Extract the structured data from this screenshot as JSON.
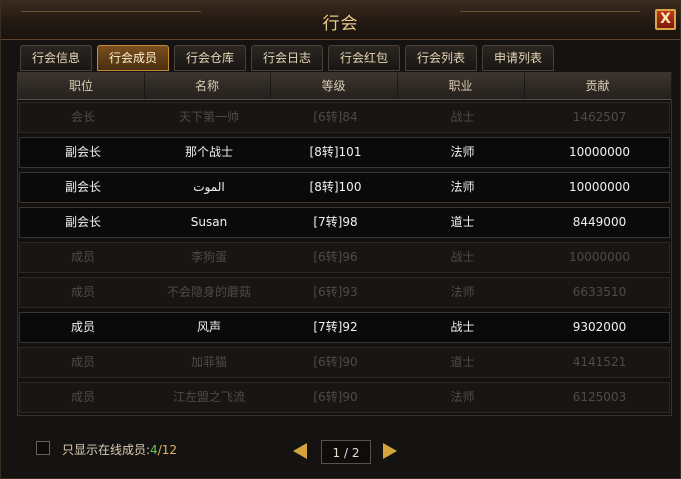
{
  "window": {
    "title": "行会",
    "close_label": "X"
  },
  "tabs": [
    {
      "label": "行会信息"
    },
    {
      "label": "行会成员"
    },
    {
      "label": "行会仓库"
    },
    {
      "label": "行会日志"
    },
    {
      "label": "行会红包"
    },
    {
      "label": "行会列表"
    },
    {
      "label": "申请列表"
    }
  ],
  "active_tab": 1,
  "columns": [
    "职位",
    "名称",
    "等级",
    "职业",
    "贡献"
  ],
  "members": [
    {
      "position": "会长",
      "name": "天下第一帅",
      "level": "[6转]84",
      "class": "战士",
      "contribution": "1462507",
      "online": false
    },
    {
      "position": "副会长",
      "name": "那个战士",
      "level": "[8转]101",
      "class": "法师",
      "contribution": "10000000",
      "online": true
    },
    {
      "position": "副会长",
      "name": "الموت",
      "level": "[8转]100",
      "class": "法师",
      "contribution": "10000000",
      "online": true
    },
    {
      "position": "副会长",
      "name": "Susan",
      "level": "[7转]98",
      "class": "道士",
      "contribution": "8449000",
      "online": true
    },
    {
      "position": "成员",
      "name": "李狗蛋",
      "level": "[6转]96",
      "class": "战士",
      "contribution": "10000000",
      "online": false
    },
    {
      "position": "成员",
      "name": "不会隐身的蘑菇",
      "level": "[6转]93",
      "class": "法师",
      "contribution": "6633510",
      "online": false
    },
    {
      "position": "成员",
      "name": "风声",
      "level": "[7转]92",
      "class": "战士",
      "contribution": "9302000",
      "online": true
    },
    {
      "position": "成员",
      "name": "加菲猫",
      "level": "[6转]90",
      "class": "道士",
      "contribution": "4141521",
      "online": false
    },
    {
      "position": "成员",
      "name": "江左盟之飞流",
      "level": "[6转]90",
      "class": "法师",
      "contribution": "6125003",
      "online": false
    }
  ],
  "footer": {
    "show_online_label": "只显示在线成员:",
    "online_count": "4",
    "separator": "/",
    "total_count": "12",
    "page_indicator": "1 / 2"
  },
  "colors": {
    "accent": "#d6a43c",
    "online_count": "#6ac84a",
    "active_tab": "#7a4f1e"
  },
  "icons": {
    "close": "close-icon",
    "prev": "prev-page-arrow-icon",
    "next": "next-page-arrow-icon"
  }
}
